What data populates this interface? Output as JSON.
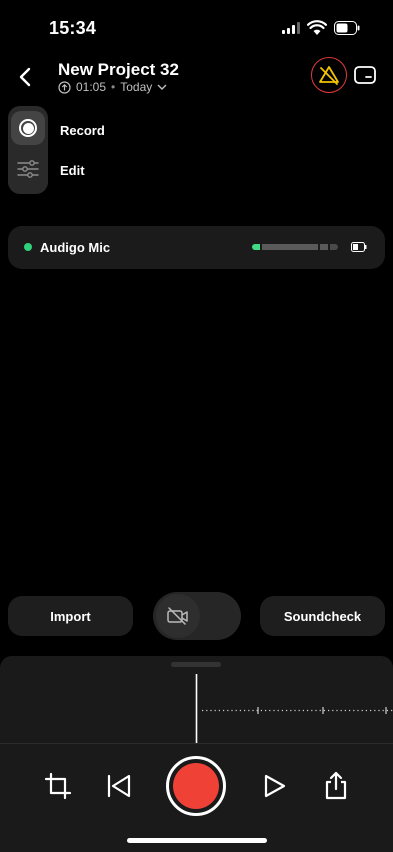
{
  "status": {
    "time": "15:34"
  },
  "header": {
    "title": "New Project 32",
    "duration": "01:05",
    "separator": "•",
    "date_filter": "Today"
  },
  "modes": [
    {
      "label": "Record",
      "selected": true
    },
    {
      "label": "Edit",
      "selected": false
    }
  ],
  "mic": {
    "name": "Audigo Mic",
    "level": 0.1,
    "status_color": "#2fd27a"
  },
  "controls": {
    "import_label": "Import",
    "soundcheck_label": "Soundcheck",
    "camera_on": false
  },
  "colors": {
    "accent_red": "#ef4136",
    "warning_yellow": "#f5c400",
    "warning_border": "#e23a3a"
  },
  "icons": [
    "back-chevron-icon",
    "upload-circle-icon",
    "chevron-down-icon",
    "warning-icon",
    "card-icon",
    "record-mode-icon",
    "sliders-icon",
    "battery-icon",
    "camera-off-icon",
    "crop-icon",
    "skip-back-icon",
    "record-icon",
    "play-icon",
    "share-icon"
  ]
}
